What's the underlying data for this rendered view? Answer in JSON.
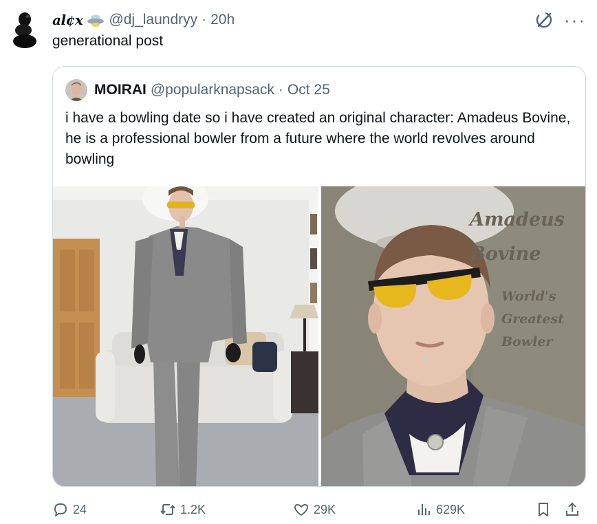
{
  "tweet": {
    "display_name": "al¢x",
    "handle": "@dj_laundryy",
    "separator": "·",
    "time": "20h",
    "text": "generational post"
  },
  "quote": {
    "name": "MOIRAI",
    "handle": "@popularknapsack",
    "separator": "·",
    "date": "Oct 25",
    "text": "i have a bowling date so i have created an original character: Amadeus Bovine, he is a professional bowler from a future where the world revolves around bowling",
    "image_overlay": {
      "title_line1": "Amadeus",
      "title_line2": "Bovine",
      "sub_line1": "World's",
      "sub_line2": "Greatest",
      "sub_line3": "Bowler"
    }
  },
  "actions": {
    "replies": "24",
    "reposts": "1.2K",
    "likes": "29K",
    "views": "629K"
  },
  "icons": [
    "grok-icon",
    "more-icon",
    "reply-icon",
    "repost-icon",
    "like-icon",
    "views-icon",
    "bookmark-icon",
    "share-icon"
  ]
}
